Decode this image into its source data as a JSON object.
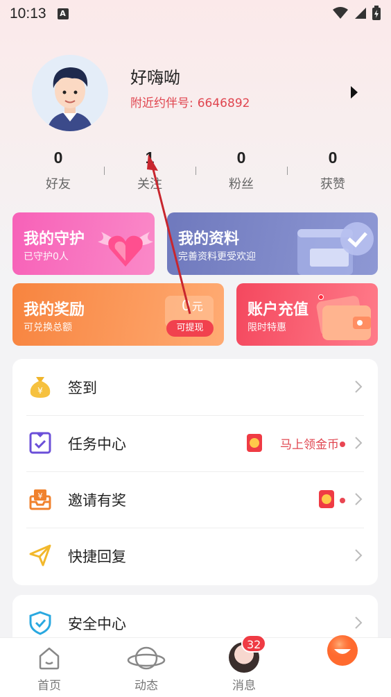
{
  "status_bar": {
    "time": "10:13",
    "notification": "A"
  },
  "profile": {
    "username": "好嗨呦",
    "uid_label": "附近约伴号:",
    "uid_value": "6646892"
  },
  "stats": [
    {
      "value": "0",
      "label": "好友"
    },
    {
      "value": "1",
      "label": "关注"
    },
    {
      "value": "0",
      "label": "粉丝"
    },
    {
      "value": "0",
      "label": "获赞"
    }
  ],
  "cards": {
    "guard": {
      "title": "我的守护",
      "subtitle": "已守护0人"
    },
    "profile": {
      "title": "我的资料",
      "subtitle": "完善资料更受欢迎"
    },
    "reward": {
      "title": "我的奖励",
      "subtitle": "可兑换总额",
      "amount": "0",
      "unit": "元",
      "button": "可提现"
    },
    "recharge": {
      "title": "账户充值",
      "subtitle": "限时特惠"
    }
  },
  "menu": {
    "checkin": "签到",
    "task_center": "任务中心",
    "task_promo": "马上领金币",
    "invite": "邀请有奖",
    "quick_reply": "快捷回复",
    "security": "安全中心"
  },
  "tabbar": {
    "home": "首页",
    "moments": "动态",
    "messages": "消息",
    "message_count": "32"
  },
  "colors": {
    "accent_red": "#e0454f",
    "guard_pink": "#f761b8",
    "profile_purple": "#6f79bd",
    "reward_orange": "#f7843f",
    "recharge_red": "#f4485e"
  }
}
